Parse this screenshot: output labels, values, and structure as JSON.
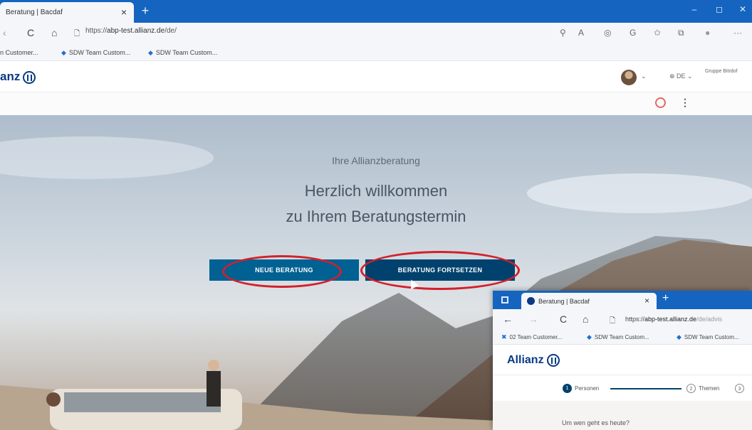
{
  "browser": {
    "tab_title": "Beratung | Bacdaf",
    "tab_close": "×",
    "new_tab": "+",
    "window_controls": {
      "minimize": "–",
      "restore": "◻",
      "close": "✕"
    },
    "url_prefix": "https://",
    "url_host": "abp-test.allianz.de",
    "url_path": "/de/",
    "nav": {
      "back": "‹",
      "reload": "C",
      "home": "⌂",
      "lock": "🗋"
    },
    "toolbar_icons": [
      "zoom-icon",
      "read-aloud-icon",
      "extension-icon",
      "sync-icon",
      "favorites-icon",
      "collections-icon",
      "profile-icon",
      "more-icon"
    ],
    "toolbar_glyphs": [
      "⚲",
      "A",
      "◎",
      "G",
      "✩",
      "⧉",
      "●",
      "···"
    ],
    "favorites": [
      {
        "label": "n Customer..."
      },
      {
        "label": "SDW Team Custom..."
      },
      {
        "label": "SDW Team Custom..."
      }
    ]
  },
  "site": {
    "logo_text": "Allianz",
    "logo_visible": "anz",
    "avatar_chevron": "⌄",
    "language": "⊕ DE ⌄",
    "group_label": "Gruppe Bitrdof",
    "kebab": "⋮"
  },
  "hero": {
    "subtitle": "Ihre Allianzberatung",
    "title_line1": "Herzlich willkommen",
    "title_line2": "zu Ihrem Beratungstermin",
    "btn_new": "NEUE BERATUNG",
    "btn_continue": "BERATUNG FORTSETZEN"
  },
  "popup": {
    "tab_title": "Beratung | Bacdaf",
    "tab_close": "×",
    "new_tab": "+",
    "nav": {
      "back": "←",
      "forward": "→",
      "reload": "C",
      "home": "⌂",
      "page": "🗋"
    },
    "url_prefix": "https://",
    "url_host": "abp-test.allianz.de",
    "url_path": "/de/advis",
    "favorites": [
      {
        "label": "02 Team Customer..."
      },
      {
        "label": "SDW Team Custom..."
      },
      {
        "label": "SDW Team Custom..."
      }
    ],
    "logo_text": "Allianz",
    "steps": [
      {
        "num": "1",
        "label": "Personen"
      },
      {
        "num": "2",
        "label": "Themen"
      },
      {
        "num": "3",
        "label": ""
      }
    ],
    "question": "Um wen geht es heute?"
  }
}
